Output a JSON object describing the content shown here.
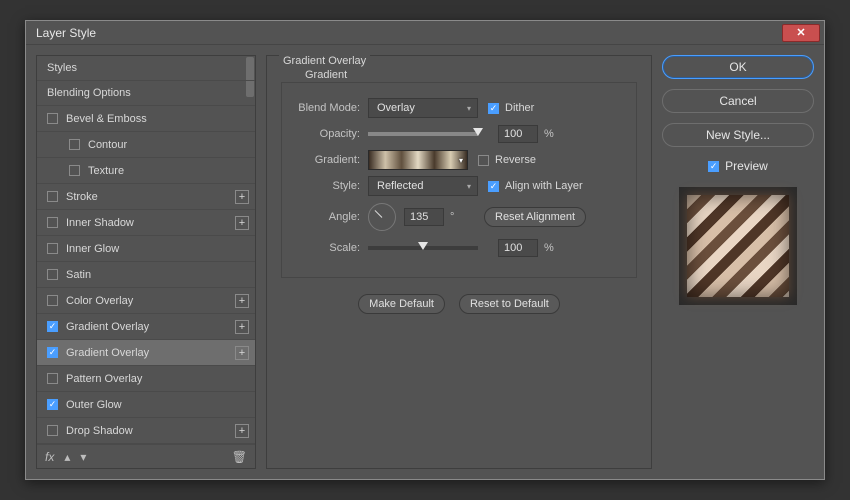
{
  "window": {
    "title": "Layer Style"
  },
  "sidebar": {
    "header_styles": "Styles",
    "header_blending": "Blending Options",
    "items": [
      {
        "label": "Bevel & Emboss",
        "checked": false,
        "plus": false
      },
      {
        "label": "Contour",
        "checked": false,
        "plus": false,
        "indent": true
      },
      {
        "label": "Texture",
        "checked": false,
        "plus": false,
        "indent": true
      },
      {
        "label": "Stroke",
        "checked": false,
        "plus": true
      },
      {
        "label": "Inner Shadow",
        "checked": false,
        "plus": true
      },
      {
        "label": "Inner Glow",
        "checked": false,
        "plus": false
      },
      {
        "label": "Satin",
        "checked": false,
        "plus": false
      },
      {
        "label": "Color Overlay",
        "checked": false,
        "plus": true
      },
      {
        "label": "Gradient Overlay",
        "checked": true,
        "plus": true
      },
      {
        "label": "Gradient Overlay",
        "checked": true,
        "plus": true,
        "selected": true
      },
      {
        "label": "Pattern Overlay",
        "checked": false,
        "plus": false
      },
      {
        "label": "Outer Glow",
        "checked": true,
        "plus": false
      },
      {
        "label": "Drop Shadow",
        "checked": false,
        "plus": true
      }
    ],
    "footer_fx": "fx"
  },
  "panel": {
    "group_title": "Gradient Overlay",
    "legend": "Gradient",
    "blend_mode": {
      "label": "Blend Mode:",
      "value": "Overlay"
    },
    "dither": {
      "label": "Dither",
      "checked": true
    },
    "opacity": {
      "label": "Opacity:",
      "value": "100",
      "unit": "%"
    },
    "gradient_label": "Gradient:",
    "reverse": {
      "label": "Reverse",
      "checked": false
    },
    "style": {
      "label": "Style:",
      "value": "Reflected"
    },
    "align": {
      "label": "Align with Layer",
      "checked": true
    },
    "angle": {
      "label": "Angle:",
      "value": "135",
      "unit": "°"
    },
    "reset_align": "Reset Alignment",
    "scale": {
      "label": "Scale:",
      "value": "100",
      "unit": "%"
    },
    "make_default": "Make Default",
    "reset_default": "Reset to Default"
  },
  "right": {
    "ok": "OK",
    "cancel": "Cancel",
    "new_style": "New Style...",
    "preview": "Preview",
    "preview_checked": true
  }
}
